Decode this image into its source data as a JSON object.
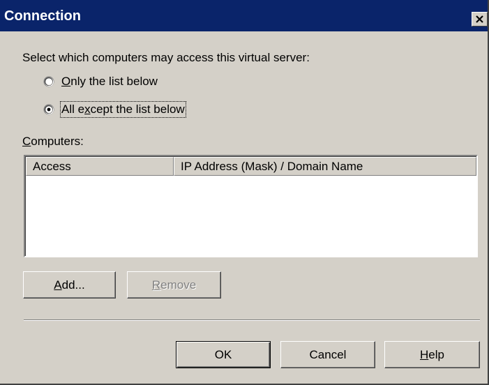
{
  "dialog": {
    "title": "Connection"
  },
  "prompt": "Select which computers may access this virtual server:",
  "radios": {
    "only_list": {
      "mnemonic": "O",
      "rest": "nly the list below",
      "checked": false
    },
    "all_except": {
      "pre": "All e",
      "mnemonic": "x",
      "rest": "cept the list below",
      "checked": true
    }
  },
  "computers_label": {
    "mnemonic": "C",
    "rest": "omputers:"
  },
  "list": {
    "columns": [
      "Access",
      "IP Address (Mask) / Domain Name"
    ],
    "rows": []
  },
  "buttons": {
    "add": {
      "mnemonic": "A",
      "rest": "dd...",
      "enabled": true
    },
    "remove": {
      "mnemonic": "R",
      "rest": "emove",
      "enabled": false
    },
    "ok": {
      "label": "OK"
    },
    "cancel": {
      "label": "Cancel"
    },
    "help": {
      "mnemonic": "H",
      "rest": "elp"
    }
  },
  "colors": {
    "titlebar": "#0a246a",
    "face": "#d4d0c8",
    "shadow": "#808080",
    "highlight": "#ffffff"
  },
  "icons": {
    "close": "close-icon",
    "radio": "radio-button"
  }
}
